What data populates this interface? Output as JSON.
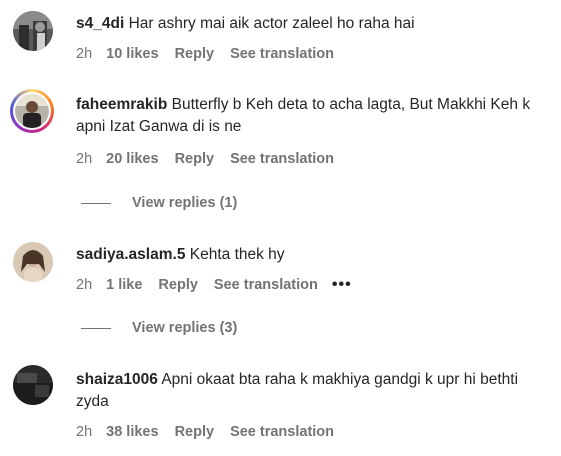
{
  "comments": [
    {
      "username": "s4_4di",
      "text": "Har ashry mai aik actor zaleel ho raha hai",
      "time": "2h",
      "likes": "10 likes",
      "reply_label": "Reply",
      "translation_label": "See translation"
    },
    {
      "username": "faheemrakib",
      "text": "Butterfly b Keh deta to acha lagta, But Makkhi Keh k apni Izat Ganwa di is ne",
      "time": "2h",
      "likes": "20 likes",
      "reply_label": "Reply",
      "translation_label": "See translation",
      "view_replies": "View replies (1)"
    },
    {
      "username": "sadiya.aslam.5",
      "text": "Kehta thek hy",
      "time": "2h",
      "likes": "1 like",
      "reply_label": "Reply",
      "translation_label": "See translation",
      "more_icon": "•••",
      "view_replies": "View replies (3)"
    },
    {
      "username": "shaiza1006",
      "text": "Apni okaat bta raha k makhiya gandgi k upr hi bethti zyda",
      "time": "2h",
      "likes": "38 likes",
      "reply_label": "Reply",
      "translation_label": "See translation"
    }
  ],
  "colors": {
    "text_primary": "#262626",
    "text_secondary": "#737373",
    "story_ring_gradient": [
      "#feda75",
      "#fa7e1e",
      "#d62976",
      "#962fbf",
      "#4f5bd5"
    ]
  },
  "icons": {
    "more": "more-options-icon"
  }
}
